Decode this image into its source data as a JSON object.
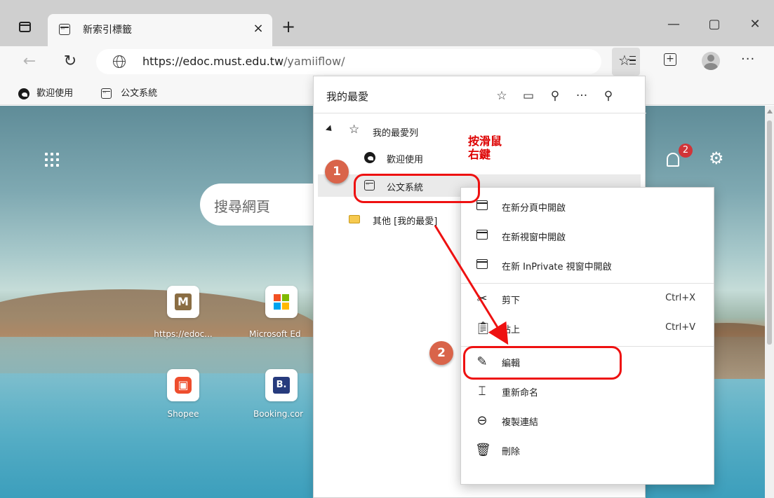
{
  "tab": {
    "title": "新索引標籤",
    "close": "×",
    "new_tab": "+"
  },
  "window": {
    "minimize": "—",
    "maximize": "▢",
    "close": "✕"
  },
  "toolbar": {
    "back": "←",
    "refresh": "↻",
    "url_host": "https://edoc.must.edu.tw",
    "url_path": "/yamiiflow/",
    "more": "···"
  },
  "bookmarks": [
    {
      "label": "歡迎使用"
    },
    {
      "label": "公文系統"
    }
  ],
  "newtab_page": {
    "search_placeholder": "搜尋網頁",
    "notification_count": "2",
    "tiles": [
      {
        "letter": "M",
        "label": "https://edoc...",
        "color": "#8a6d43"
      },
      {
        "letter": "",
        "label": "Microsoft Ed",
        "color": ""
      },
      {
        "letter": "",
        "label": "Shopee",
        "color": "#ee4d2d"
      },
      {
        "letter": "B.",
        "label": "Booking.cor",
        "color": "#273b7d"
      }
    ]
  },
  "favorites_panel": {
    "title": "我的最愛",
    "tree": [
      {
        "label": "我的最愛列"
      },
      {
        "label": "歡迎使用"
      },
      {
        "label": "公文系統"
      },
      {
        "label": "其他 [我的最愛]"
      }
    ]
  },
  "context_menu": {
    "items": [
      {
        "label": "在新分頁中開啟",
        "shortcut": ""
      },
      {
        "label": "在新視窗中開啟",
        "shortcut": ""
      },
      {
        "label": "在新 InPrivate 視窗中開啟",
        "shortcut": ""
      },
      {
        "label": "剪下",
        "shortcut": "Ctrl+X"
      },
      {
        "label": "貼上",
        "shortcut": "Ctrl+V"
      },
      {
        "label": "編輯",
        "shortcut": ""
      },
      {
        "label": "重新命名",
        "shortcut": ""
      },
      {
        "label": "複製連結",
        "shortcut": ""
      },
      {
        "label": "刪除",
        "shortcut": ""
      }
    ]
  },
  "annotations": {
    "step1": "1",
    "step2": "2",
    "note_line1": "按滑鼠",
    "note_line2": "右鍵",
    "color": "#e11111"
  }
}
